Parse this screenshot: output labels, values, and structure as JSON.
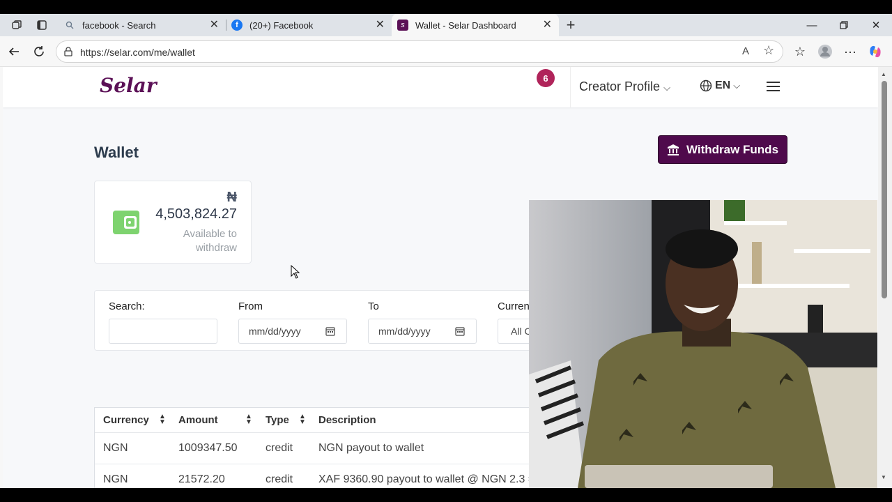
{
  "browser": {
    "tabs": [
      {
        "title": "facebook - Search",
        "favicon": "search-icon"
      },
      {
        "title": "(20+) Facebook",
        "favicon": "facebook-icon"
      },
      {
        "title": "Wallet - Selar Dashboard",
        "favicon": "selar-icon"
      }
    ],
    "url": "https://selar.com/me/wallet"
  },
  "header": {
    "logo": "Selar",
    "notification_count": "6",
    "profile_menu": "Creator Profile",
    "language": "EN"
  },
  "main": {
    "title": "Wallet",
    "withdraw_label": "Withdraw Funds",
    "balance": {
      "currency_symbol": "₦",
      "amount": "4,503,824.27",
      "caption": "Available to withdraw"
    },
    "filters": {
      "search_label": "Search:",
      "from_label": "From",
      "from_placeholder": "mm/dd/yyyy",
      "to_label": "To",
      "to_placeholder": "mm/dd/yyyy",
      "currency_label": "Curren",
      "currency_value": "All C"
    },
    "table": {
      "columns": [
        "Currency",
        "Amount",
        "Type",
        "Description"
      ],
      "rows": [
        {
          "currency": "NGN",
          "amount": "1009347.50",
          "type": "credit",
          "description": "NGN payout to wallet"
        },
        {
          "currency": "NGN",
          "amount": "21572.20",
          "type": "credit",
          "description": "XAF 9360.90 payout to wallet @ NGN 2.3 ="
        }
      ]
    }
  },
  "colors": {
    "brand": "#4f0a4c",
    "badge": "#b0245a",
    "wallet_icon": "#7ed36f"
  }
}
